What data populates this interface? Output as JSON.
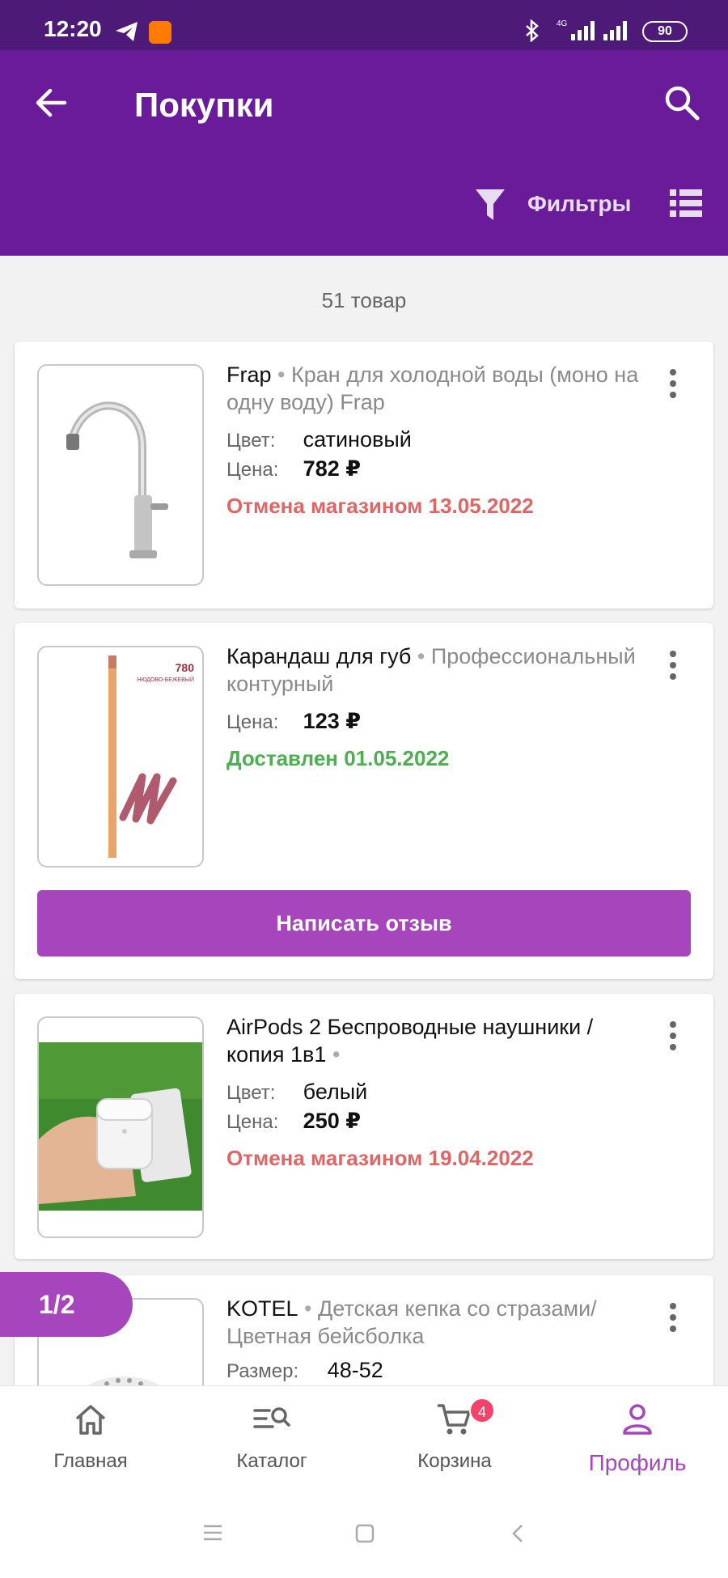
{
  "status_bar": {
    "time": "12:20",
    "battery": "90",
    "network": "4G"
  },
  "header": {
    "title": "Покупки",
    "filters_label": "Фильтры"
  },
  "count_label": "51 товар",
  "products": [
    {
      "brand": "Frap",
      "desc": "Кран для холодной воды (моно на одну воду) Frap",
      "color_label": "Цвет:",
      "color": "сатиновый",
      "price_label": "Цена:",
      "price": "782 ₽",
      "status": "Отмена магазином 13.05.2022"
    },
    {
      "brand": "Карандаш для губ",
      "desc": "Профессиональный контурный",
      "price_label": "Цена:",
      "price": "123 ₽",
      "status": "Доставлен 01.05.2022",
      "review_button": "Написать отзыв",
      "thumb_text": "780",
      "thumb_subtext": "НЮДОВО-БЕЖЕВЫЙ"
    },
    {
      "brand": "AirPods 2 Беспроводные наушники / копия 1в1",
      "desc": "",
      "color_label": "Цвет:",
      "color": "белый",
      "price_label": "Цена:",
      "price": "250 ₽",
      "status": "Отмена магазином 19.04.2022"
    },
    {
      "brand": "KOTEL",
      "desc": "Детская кепка со стразами/Цветная бейсболка",
      "size_label": "Размер:",
      "size": "48-52"
    }
  ],
  "pager": "1/2",
  "nav": {
    "home": "Главная",
    "catalog": "Каталог",
    "cart": "Корзина",
    "cart_badge": "4",
    "profile": "Профиль"
  },
  "colors": {
    "primary": "#6a1b9a",
    "accent": "#a745bd",
    "cancel": "#e06666",
    "delivered": "#4caf50"
  }
}
